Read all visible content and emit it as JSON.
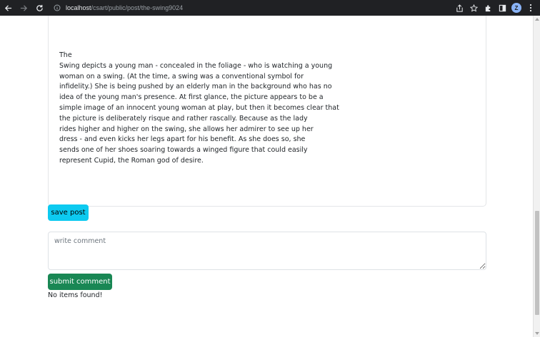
{
  "browser": {
    "url_host": "localhost",
    "url_path": "/csart/public/post/the-swing9024",
    "profile_initial": "Z"
  },
  "post": {
    "lines": [
      "The",
      "Swing depicts a young man - concealed in the foliage - who is watching a young",
      "woman on a swing. (At the time, a swing was a conventional symbol for",
      "infidelity.) She is being pushed by an elderly man in the background who has no",
      "idea of the young man's presence. At first glance, the picture appears to be a",
      "simple image of an innocent young woman at play, but then it becomes clear that",
      "the picture is deliberately risque and rather rascally. Because as the lady",
      "rides higher and higher on the swing, she allows her admirer to see up her",
      "dress - and even kicks her legs apart for his benefit. As she does so, she",
      "sends one of her shoes soaring towards a winged figure that could easily",
      "represent Cupid, the Roman god of desire."
    ]
  },
  "actions": {
    "save_label": "save post",
    "comment_placeholder": "write comment",
    "comment_value": "",
    "submit_label": "submit comment"
  },
  "comments": {
    "empty_text": "No items found!"
  },
  "colors": {
    "save_button": "#0dcaf0",
    "submit_button": "#198754",
    "chrome_bg": "#202124"
  }
}
